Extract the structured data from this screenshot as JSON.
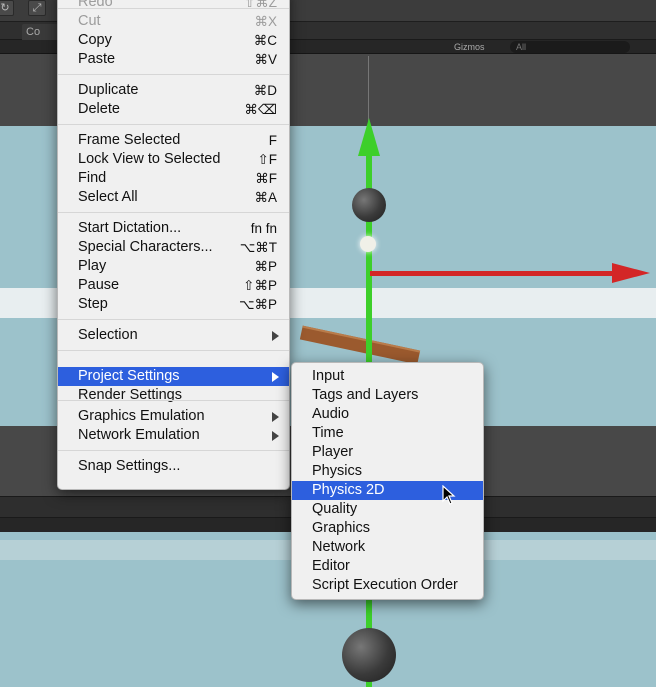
{
  "editor": {
    "tab_label": "Co",
    "gizmos_label": "Gizmos",
    "search_placeholder": "All"
  },
  "edit_menu": {
    "items": [
      {
        "label": "Redo",
        "shortcut": "⇧⌘Z",
        "disabled": true
      },
      {
        "label": "Cut",
        "shortcut": "⌘X",
        "disabled": true
      },
      {
        "label": "Copy",
        "shortcut": "⌘C"
      },
      {
        "label": "Paste",
        "shortcut": "⌘V"
      },
      {
        "label": "Duplicate",
        "shortcut": "⌘D"
      },
      {
        "label": "Delete",
        "shortcut": "⌘⌫"
      },
      {
        "label": "Frame Selected",
        "shortcut": "F"
      },
      {
        "label": "Lock View to Selected",
        "shortcut": "⇧F"
      },
      {
        "label": "Find",
        "shortcut": "⌘F"
      },
      {
        "label": "Select All",
        "shortcut": "⌘A"
      },
      {
        "label": "Start Dictation...",
        "shortcut": "fn fn"
      },
      {
        "label": "Special Characters...",
        "shortcut": "⌥⌘T"
      },
      {
        "label": "Play",
        "shortcut": "⌘P"
      },
      {
        "label": "Pause",
        "shortcut": "⇧⌘P"
      },
      {
        "label": "Step",
        "shortcut": "⌥⌘P"
      },
      {
        "label": "Selection",
        "submenu": true
      },
      {
        "label": "Project Settings",
        "submenu": true,
        "selected": true
      },
      {
        "label": "Render Settings"
      },
      {
        "label": "Graphics Emulation",
        "submenu": true
      },
      {
        "label": "Network Emulation",
        "submenu": true
      },
      {
        "label": "Snap Settings..."
      }
    ]
  },
  "project_settings_menu": {
    "items": [
      {
        "label": "Input"
      },
      {
        "label": "Tags and Layers"
      },
      {
        "label": "Audio"
      },
      {
        "label": "Time"
      },
      {
        "label": "Player"
      },
      {
        "label": "Physics"
      },
      {
        "label": "Physics 2D",
        "selected": true
      },
      {
        "label": "Quality"
      },
      {
        "label": "Graphics"
      },
      {
        "label": "Network"
      },
      {
        "label": "Editor"
      },
      {
        "label": "Script Execution Order"
      }
    ]
  },
  "colors": {
    "menu_bg": "#f0f0f0",
    "selection": "#2d5fde",
    "sky": "#9cc2cb",
    "y_axis": "#3dcf2a",
    "x_axis": "#d32626"
  }
}
